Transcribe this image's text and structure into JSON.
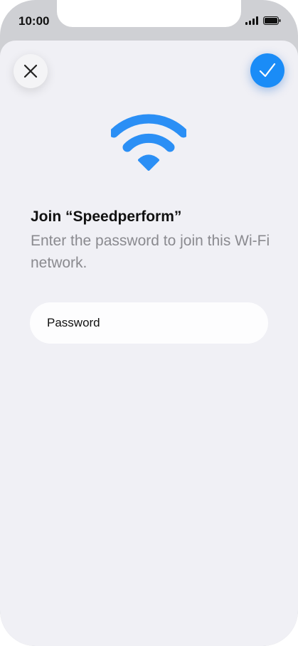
{
  "status_bar": {
    "time": "10:00",
    "icons": [
      "cellular-signal-icon",
      "battery-icon"
    ]
  },
  "toolbar": {
    "close_icon": "close-icon",
    "confirm_icon": "checkmark-icon"
  },
  "network": {
    "icon": "wifi-icon",
    "title": "Join “Speedperform”",
    "subtitle": "Enter the password to join this Wi-Fi network."
  },
  "form": {
    "password_placeholder": "Password"
  },
  "colors": {
    "accent": "#1a8cf7",
    "wifi": "#2b8ff5",
    "sheet_background": "#f0f0f5",
    "secondary_text": "#8a8a8f"
  }
}
